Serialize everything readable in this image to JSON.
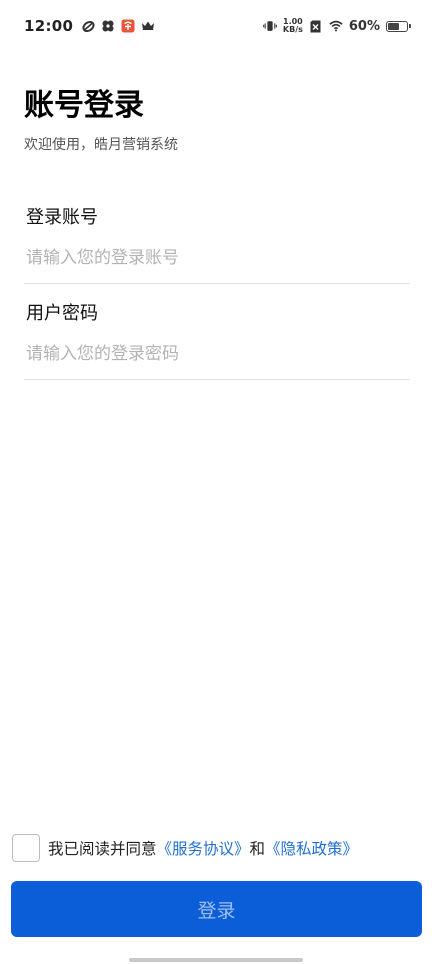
{
  "status_bar": {
    "time": "12:00",
    "net_speed_value": "1.00",
    "net_speed_unit": "KB/s",
    "battery_percent": "60%",
    "battery_level": 0.6,
    "icons": [
      "link-icon",
      "flower-icon",
      "app-badge-icon",
      "crown-icon",
      "vibrate-icon",
      "no-sim-icon",
      "wifi-icon",
      "battery-icon"
    ]
  },
  "header": {
    "title": "账号登录",
    "subtitle": "欢迎使用，皓月营销系统"
  },
  "form": {
    "account": {
      "label": "登录账号",
      "placeholder": "请输入您的登录账号",
      "value": ""
    },
    "password": {
      "label": "用户密码",
      "placeholder": "请输入您的登录密码",
      "value": ""
    }
  },
  "agreement": {
    "checked": false,
    "prefix": "我已阅读并同意",
    "service_link": "《服务协议》",
    "and": "和",
    "privacy_link": "《隐私政策》"
  },
  "login_button": {
    "label": "登录"
  },
  "colors": {
    "primary": "#0b5ed7",
    "link": "#1f6fd0",
    "placeholder": "#b3b3b3",
    "button_text_disabled": "#9fc0ef"
  }
}
